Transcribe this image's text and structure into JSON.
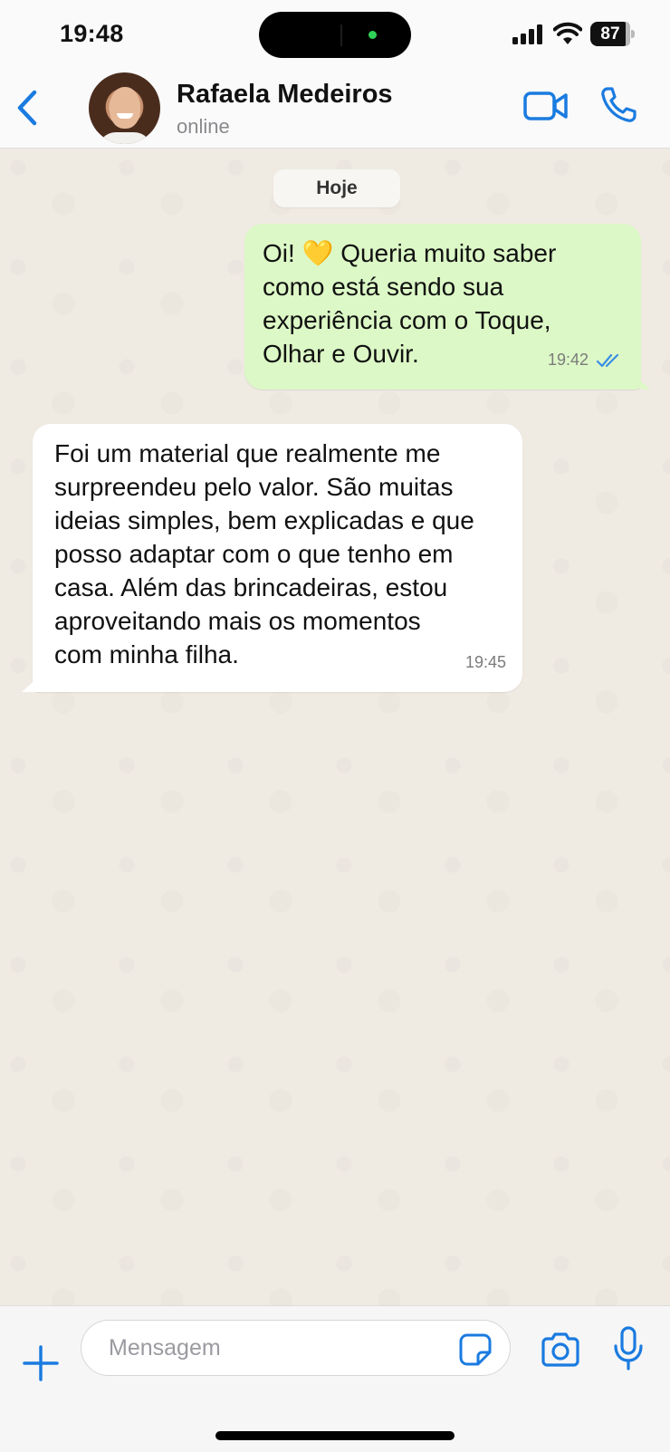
{
  "status_bar": {
    "time": "19:48",
    "battery": "87"
  },
  "header": {
    "contact_name": "Rafaela Medeiros",
    "contact_status": "online"
  },
  "chat": {
    "date_label": "Hoje",
    "messages": [
      {
        "direction": "outgoing",
        "text": "Oi! 💛 Queria muito saber\ncomo está sendo sua\nexperiência com o Toque,\nOlhar e Ouvir.",
        "time": "19:42",
        "read": true
      },
      {
        "direction": "incoming",
        "text": "Foi um material que realmente me\nsurpreendeu pelo valor. São muitas\nideias simples, bem explicadas e que\nposso adaptar com o que tenho em\ncasa. Além das brincadeiras, estou\naproveitando mais os momentos\ncom minha filha.",
        "time": "19:45"
      }
    ]
  },
  "composer": {
    "placeholder": "Mensagem"
  },
  "colors": {
    "accent": "#1a7be0",
    "outgoing_bubble": "#dcf8c6",
    "incoming_bubble": "#ffffff",
    "chat_background": "#efeae2",
    "read_check": "#3a8ee6"
  }
}
